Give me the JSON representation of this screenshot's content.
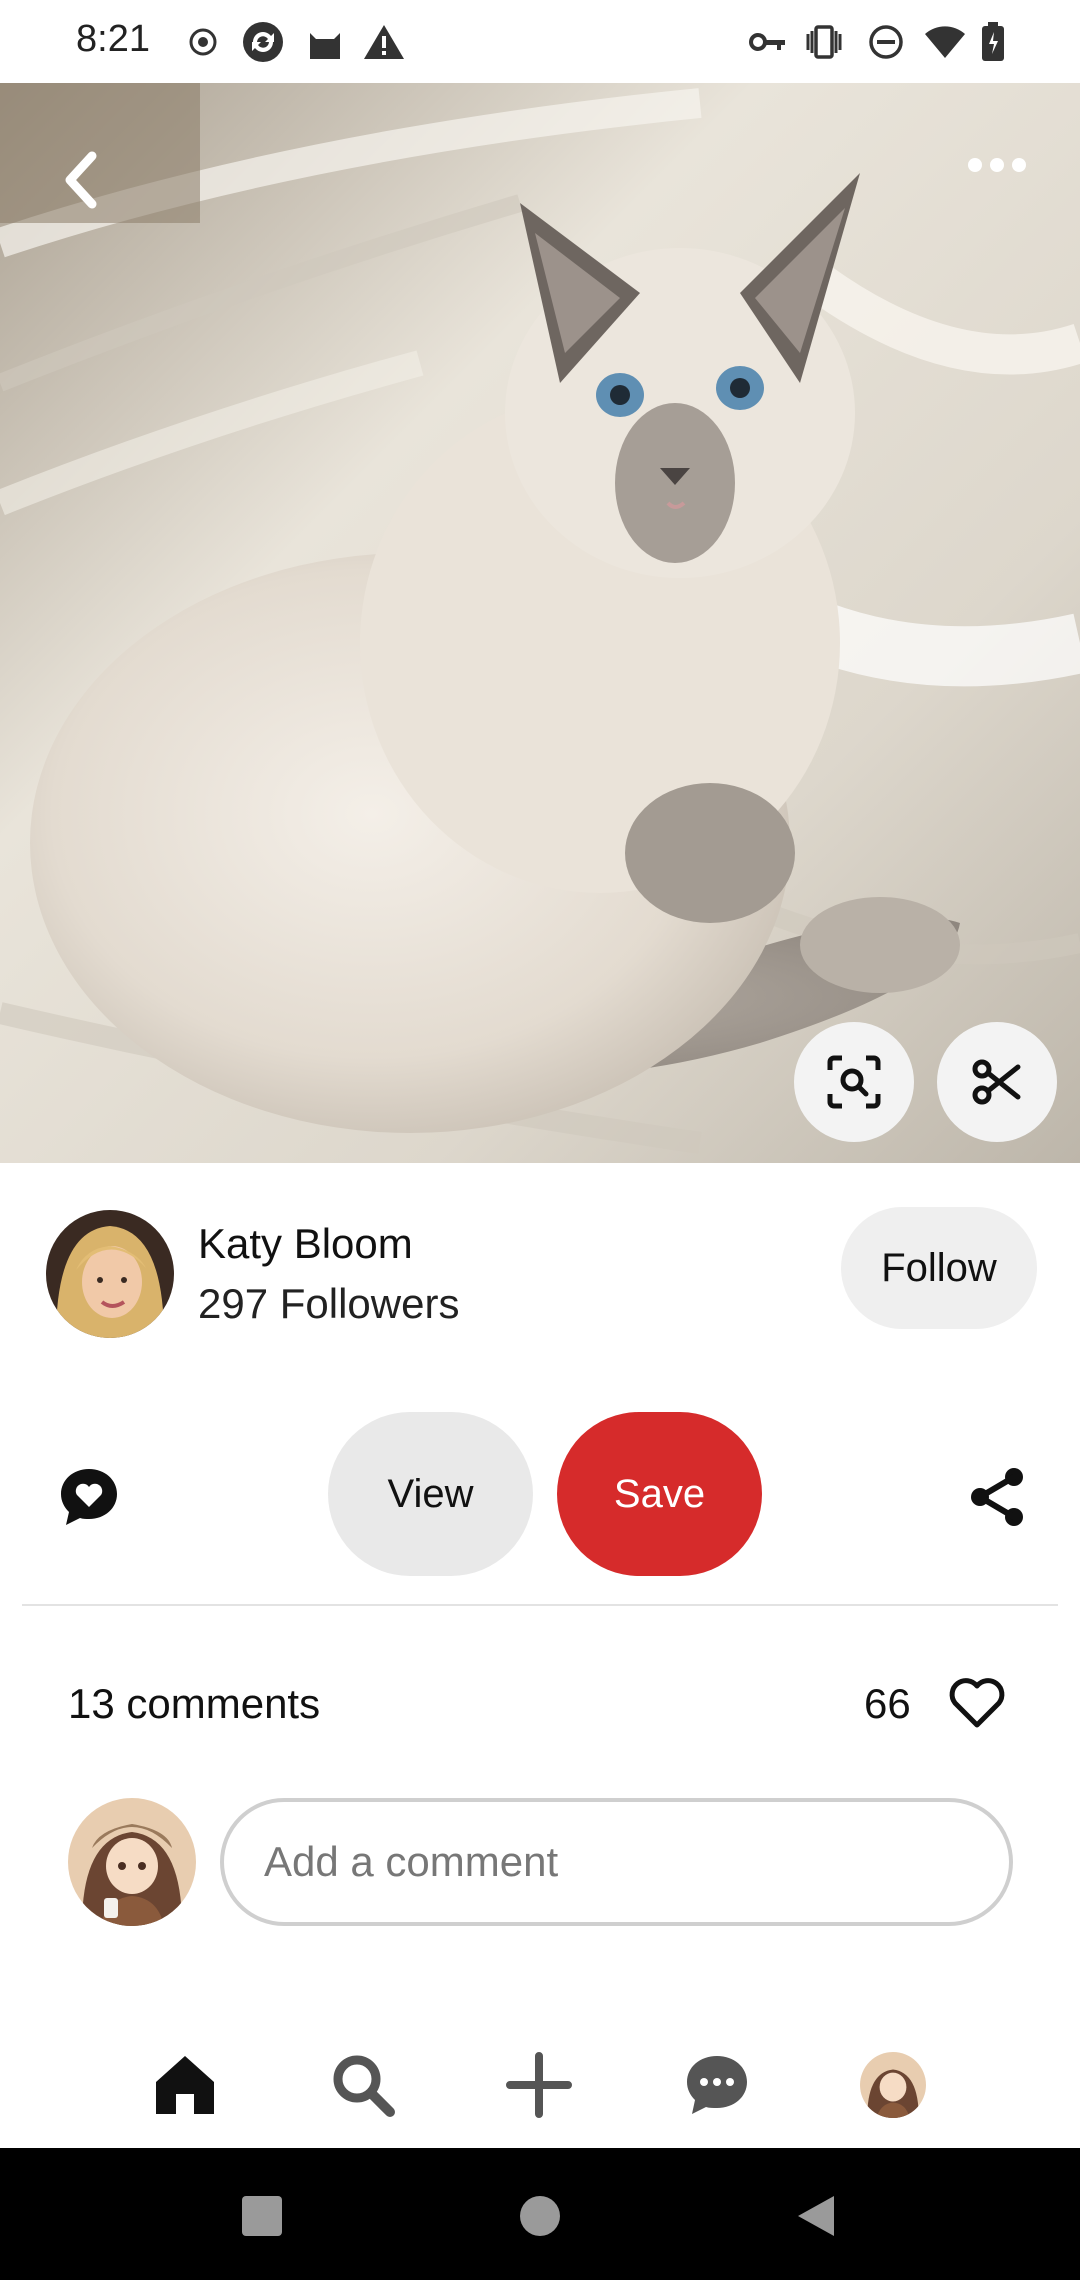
{
  "status_bar": {
    "time": "8:21",
    "left_icons": [
      "record-icon",
      "sync-icon",
      "cat-app-icon",
      "warning-icon"
    ],
    "right_icons": [
      "vpn-key-icon",
      "vibrate-icon",
      "do-not-disturb-icon",
      "wifi-icon",
      "battery-icon"
    ]
  },
  "pin": {
    "image_description": "fluffy ragdoll kitten on white blanket",
    "top_controls": [
      "back-icon",
      "more-icon"
    ],
    "overlay_buttons": [
      "visual-search-icon",
      "scissors-icon"
    ]
  },
  "creator": {
    "name": "Katy Bloom",
    "followers": "297 Followers",
    "follow_label": "Follow"
  },
  "actions": {
    "view_label": "View",
    "save_label": "Save",
    "left_icon": "chat-heart-icon",
    "right_icon": "share-icon"
  },
  "comments": {
    "count_label": "13 comments",
    "likes": "66",
    "input_placeholder": "Add a comment"
  },
  "bottom_tabs": [
    "home",
    "search",
    "create",
    "messages",
    "profile"
  ],
  "colors": {
    "save": "#d62b2b",
    "follow_bg": "#efefef",
    "view_bg": "#e9e9e9"
  }
}
